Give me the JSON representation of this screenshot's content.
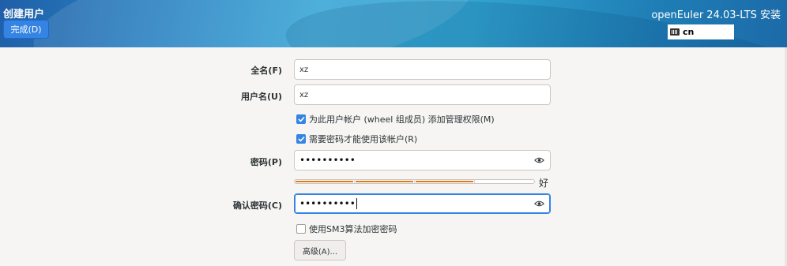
{
  "header": {
    "spoke_title": "创建用户",
    "done_button": "完成(D)",
    "product_title": "openEuler 24.03-LTS 安装",
    "keyboard_layout": "cn",
    "keyboard_icon": "keyboard-icon"
  },
  "form": {
    "fullname_label": "全名(F)",
    "fullname_value": "xz",
    "username_label": "用户名(U)",
    "username_value": "xz",
    "admin_checkbox": {
      "label": "为此用户帐户 (wheel 组成员) 添加管理权限(M)",
      "checked": true
    },
    "require_password_checkbox": {
      "label": "需要密码才能使用该帐户(R)",
      "checked": true
    },
    "password_label": "密码(P)",
    "password_value": "••••••••••",
    "password_strength": {
      "filled_segments": 3,
      "total_segments": 4,
      "label": "好"
    },
    "confirm_label": "确认密码(C)",
    "confirm_value": "••••••••••",
    "sm3_checkbox": {
      "label": "使用SM3算法加密密码",
      "checked": false
    },
    "advanced_button": "高级(A)..."
  },
  "colors": {
    "accent": "#3584e4",
    "strength_fill": "#e07b1a",
    "background": "#f6f5f4"
  }
}
